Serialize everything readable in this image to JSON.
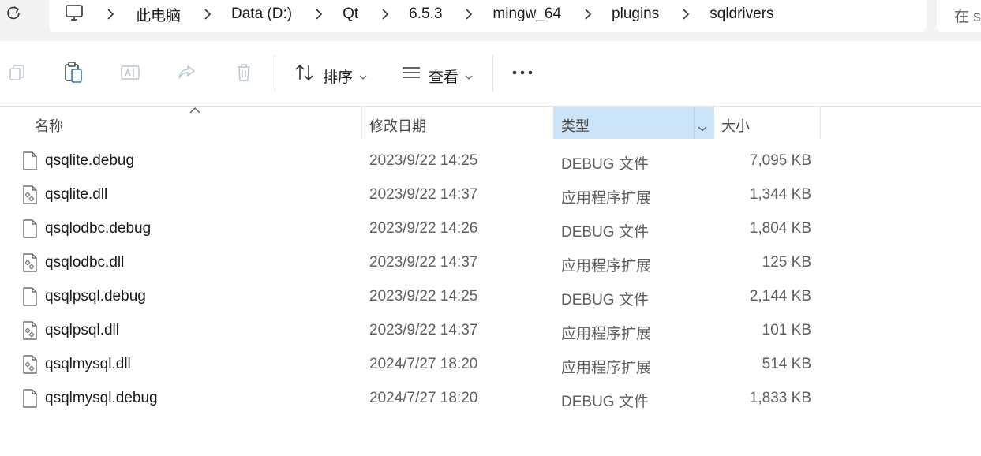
{
  "address": {
    "crumbs": [
      "此电脑",
      "Data (D:)",
      "Qt",
      "6.5.3",
      "mingw_64",
      "plugins",
      "sqldrivers"
    ],
    "search_prefix": "在 s"
  },
  "toolbar": {
    "sort_label": "排序",
    "view_label": "查看",
    "more_label": "..."
  },
  "columns": {
    "name": "名称",
    "date": "修改日期",
    "type": "类型",
    "size": "大小"
  },
  "files": [
    {
      "name": "qsqlite.debug",
      "date": "2023/9/22 14:25",
      "type": "DEBUG 文件",
      "size": "7,095 KB",
      "icon": "file-icon"
    },
    {
      "name": "qsqlite.dll",
      "date": "2023/9/22 14:37",
      "type": "应用程序扩展",
      "size": "1,344 KB",
      "icon": "dll-icon"
    },
    {
      "name": "qsqlodbc.debug",
      "date": "2023/9/22 14:26",
      "type": "DEBUG 文件",
      "size": "1,804 KB",
      "icon": "file-icon"
    },
    {
      "name": "qsqlodbc.dll",
      "date": "2023/9/22 14:37",
      "type": "应用程序扩展",
      "size": "125 KB",
      "icon": "dll-icon"
    },
    {
      "name": "qsqlpsql.debug",
      "date": "2023/9/22 14:25",
      "type": "DEBUG 文件",
      "size": "2,144 KB",
      "icon": "file-icon"
    },
    {
      "name": "qsqlpsql.dll",
      "date": "2023/9/22 14:37",
      "type": "应用程序扩展",
      "size": "101 KB",
      "icon": "dll-icon"
    },
    {
      "name": "qsqlmysql.dll",
      "date": "2024/7/27 18:20",
      "type": "应用程序扩展",
      "size": "514 KB",
      "icon": "dll-icon"
    },
    {
      "name": "qsqlmysql.debug",
      "date": "2024/7/27 18:20",
      "type": "DEBUG 文件",
      "size": "1,833 KB",
      "icon": "file-icon"
    }
  ],
  "colors": {
    "selected_header": "#cce4f7",
    "topbar_bg": "#f3f3f3"
  }
}
